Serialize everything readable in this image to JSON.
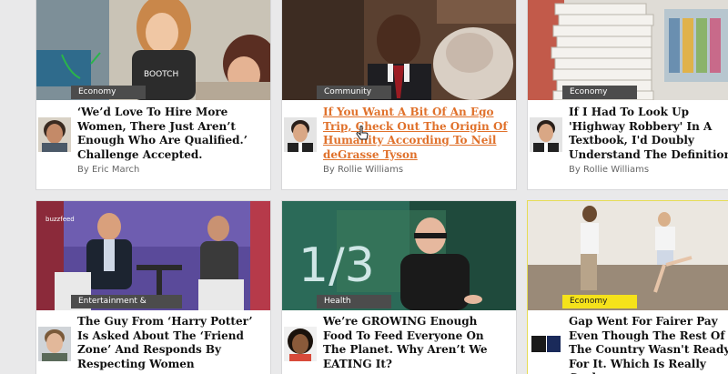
{
  "cards": [
    {
      "category": "Economy",
      "title": "‘We’d Love To Hire More Women, There Just Aren’t Enough Who Are Qualified.’ Challenge Accepted.",
      "author": "By Eric March"
    },
    {
      "category": "Community",
      "title": "If You Want A Bit Of An Ego Trip, Check Out The Origin Of Humanity According To Neil deGrasse Tyson",
      "author": "By Rollie Williams"
    },
    {
      "category": "Economy",
      "title": "If I Had To Look Up 'Highway Robbery' In A Textbook, I'd Doubly Understand The Definition",
      "author": "By Rollie Williams"
    },
    {
      "category": "Entertainment & Culture",
      "title": "The Guy From ‘Harry Potter’ Is Asked About The ‘Friend Zone’ And Responds By Respecting Women",
      "author": ""
    },
    {
      "category": "Health",
      "title": "We’re GROWING Enough Food To Feed Everyone On The Planet. Why Aren’t We EATING It?",
      "author": ""
    },
    {
      "category": "Economy",
      "title": "Gap Went For Fairer Pay Even Though The Rest Of The Country Wasn't Ready For It. Which Is Really Cool",
      "author": ""
    }
  ],
  "thumb_text": {
    "sign": "1/3",
    "shirt": "BOOTCH",
    "logo": "buzzfeed"
  },
  "colors": {
    "page_bg": "#e9e9ea",
    "category_bg": "#4c4c4c",
    "featured_category_bg": "#f5e21a",
    "hover_link": "#e0712b"
  },
  "icons": {
    "cursor": "hand-pointer-icon"
  }
}
